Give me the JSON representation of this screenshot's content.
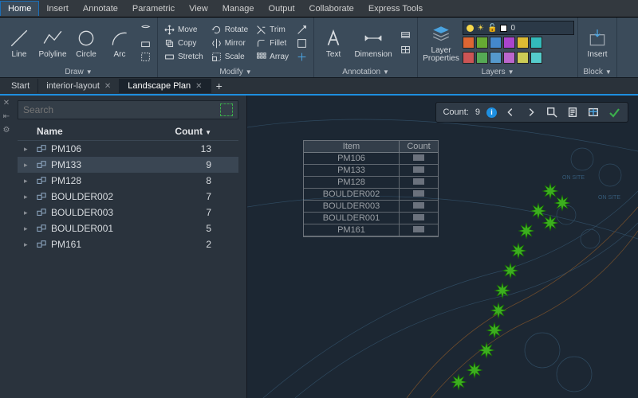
{
  "menu": {
    "tabs": [
      "Home",
      "Insert",
      "Annotate",
      "Parametric",
      "View",
      "Manage",
      "Output",
      "Collaborate",
      "Express Tools"
    ],
    "active": 0
  },
  "ribbon": {
    "draw": {
      "title": "Draw",
      "line": "Line",
      "polyline": "Polyline",
      "circle": "Circle",
      "arc": "Arc"
    },
    "modify": {
      "title": "Modify",
      "move": "Move",
      "copy": "Copy",
      "stretch": "Stretch",
      "rotate": "Rotate",
      "mirror": "Mirror",
      "scale": "Scale",
      "trim": "Trim",
      "fillet": "Fillet",
      "array": "Array"
    },
    "annotation": {
      "title": "Annotation",
      "text": "Text",
      "dimension": "Dimension"
    },
    "layers": {
      "title": "Layers",
      "props": "Layer\nProperties",
      "current": "0"
    },
    "block": {
      "title": "Block",
      "insert": "Insert"
    }
  },
  "doctabs": {
    "items": [
      "Start",
      "interior-layout",
      "Landscape Plan"
    ],
    "active": 2
  },
  "palette": {
    "search_placeholder": "Search",
    "header_name": "Name",
    "header_count": "Count",
    "rows": [
      {
        "name": "PM106",
        "count": "13"
      },
      {
        "name": "PM133",
        "count": "9"
      },
      {
        "name": "PM128",
        "count": "8"
      },
      {
        "name": "BOULDER002",
        "count": "7"
      },
      {
        "name": "BOULDER003",
        "count": "7"
      },
      {
        "name": "BOULDER001",
        "count": "5"
      },
      {
        "name": "PM161",
        "count": "2"
      }
    ],
    "active": 1
  },
  "overlay_table": {
    "item_h": "Item",
    "count_h": "Count",
    "rows": [
      "PM106",
      "PM133",
      "PM128",
      "BOULDER002",
      "BOULDER003",
      "BOULDER001",
      "PM161"
    ]
  },
  "nav": {
    "count_label": "Count:",
    "count_value": "9"
  },
  "canvas": {
    "onsite_label": "ON SITE"
  },
  "chart_data": {
    "type": "table",
    "title": "Block Count",
    "columns": [
      "Item",
      "Count"
    ],
    "rows": [
      [
        "PM106",
        13
      ],
      [
        "PM133",
        9
      ],
      [
        "PM128",
        8
      ],
      [
        "BOULDER002",
        7
      ],
      [
        "BOULDER003",
        7
      ],
      [
        "BOULDER001",
        5
      ],
      [
        "PM161",
        2
      ]
    ]
  }
}
